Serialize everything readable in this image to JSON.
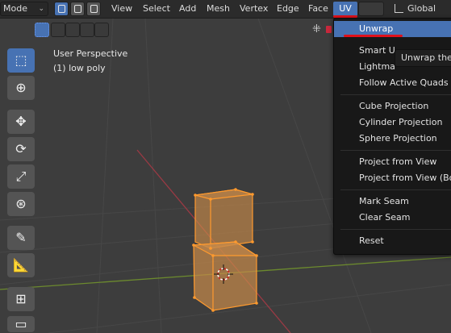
{
  "header": {
    "mode_label": "Mode",
    "menus": [
      "View",
      "Select",
      "Add",
      "Mesh",
      "Vertex",
      "Edge",
      "Face",
      "UV"
    ],
    "active_menu": "UV",
    "orientation_label": "Global"
  },
  "viewport": {
    "perspective_label": "User Perspective",
    "object_label": "(1) low poly"
  },
  "uv_menu": {
    "items": [
      "Unwrap",
      "Smart U",
      "Lightma",
      "Follow Active Quads",
      "Cube Projection",
      "Cylinder Projection",
      "Sphere Projection",
      "Project from View",
      "Project from View (Boun",
      "Mark Seam",
      "Clear Seam",
      "Reset"
    ],
    "highlighted": "Unwrap",
    "tooltip": "Unwrap the m"
  },
  "toolbar": {
    "tools": [
      "select-box-icon",
      "cursor-icon",
      "move-icon",
      "rotate-icon",
      "scale-icon",
      "transform-icon",
      "annotate-icon",
      "measure-icon",
      "add-cube-icon",
      "extrude-icon"
    ]
  },
  "colors": {
    "accent": "#4772b3",
    "annotation_red": "#e0101a",
    "mesh_orange": "#f0a040"
  }
}
